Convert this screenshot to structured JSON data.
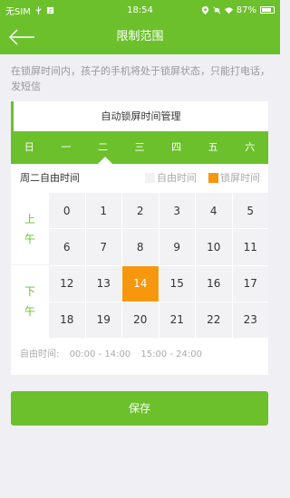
{
  "status_bar": {
    "carrier": "无SIM",
    "time": "18:54",
    "battery": "87%"
  },
  "nav": {
    "title": "限制范围",
    "back_icon": "back-arrow-icon"
  },
  "description": "在锁屏时间内，孩子的手机将处于锁屏状态，只能打电话，发短信",
  "card": {
    "title": "自动锁屏时间管理",
    "days": [
      "日",
      "一",
      "二",
      "三",
      "四",
      "五",
      "六"
    ],
    "selected_day_index": 2,
    "selected_day_label": "周二自由时间",
    "legend": {
      "free": "自由时间",
      "locked": "锁屏时间",
      "free_color": "#f2f2f4",
      "locked_color": "#f7970e"
    },
    "periods": {
      "am": [
        "上",
        "午"
      ],
      "pm": [
        "下",
        "午"
      ]
    },
    "hours": [
      {
        "label": "0",
        "locked": false
      },
      {
        "label": "1",
        "locked": false
      },
      {
        "label": "2",
        "locked": false
      },
      {
        "label": "3",
        "locked": false
      },
      {
        "label": "4",
        "locked": false
      },
      {
        "label": "5",
        "locked": false
      },
      {
        "label": "6",
        "locked": false
      },
      {
        "label": "7",
        "locked": false
      },
      {
        "label": "8",
        "locked": false
      },
      {
        "label": "9",
        "locked": false
      },
      {
        "label": "10",
        "locked": false
      },
      {
        "label": "11",
        "locked": false
      },
      {
        "label": "12",
        "locked": false
      },
      {
        "label": "13",
        "locked": false
      },
      {
        "label": "14",
        "locked": true
      },
      {
        "label": "15",
        "locked": false
      },
      {
        "label": "16",
        "locked": false
      },
      {
        "label": "17",
        "locked": false
      },
      {
        "label": "18",
        "locked": false
      },
      {
        "label": "19",
        "locked": false
      },
      {
        "label": "20",
        "locked": false
      },
      {
        "label": "21",
        "locked": false
      },
      {
        "label": "22",
        "locked": false
      },
      {
        "label": "23",
        "locked": false
      }
    ],
    "free_summary": {
      "label": "自由时间:",
      "ranges": [
        "00:00 - 14:00",
        "15:00 - 24:00"
      ]
    }
  },
  "save_label": "保存",
  "colors": {
    "primary": "#6cc02c",
    "locked": "#f7970e",
    "background": "#efeff4"
  }
}
